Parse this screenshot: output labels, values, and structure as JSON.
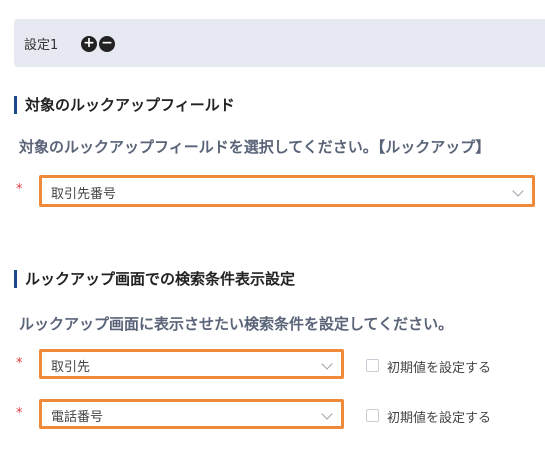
{
  "header": {
    "title": "設定1",
    "add_icon": "plus-circle-icon",
    "remove_icon": "minus-circle-icon"
  },
  "section1": {
    "title": "対象のルックアップフィールド",
    "description": "対象のルックアップフィールドを選択してください。【ルックアップ】",
    "required_mark": "*",
    "select_value": "取引先番号"
  },
  "section2": {
    "title": "ルックアップ画面での検索条件表示設定",
    "description": "ルックアップ画面に表示させたい検索条件を設定してください。",
    "rows": [
      {
        "required_mark": "*",
        "select_value": "取引先",
        "checkbox_label": "初期値を設定する",
        "checked": false
      },
      {
        "required_mark": "*",
        "select_value": "電話番号",
        "checkbox_label": "初期値を設定する",
        "checked": false
      }
    ]
  },
  "colors": {
    "accent_border": "#ef8a3a",
    "section_bar": "#1a4a8c",
    "required": "#e03c3c",
    "header_bg": "#e6e9f2"
  }
}
